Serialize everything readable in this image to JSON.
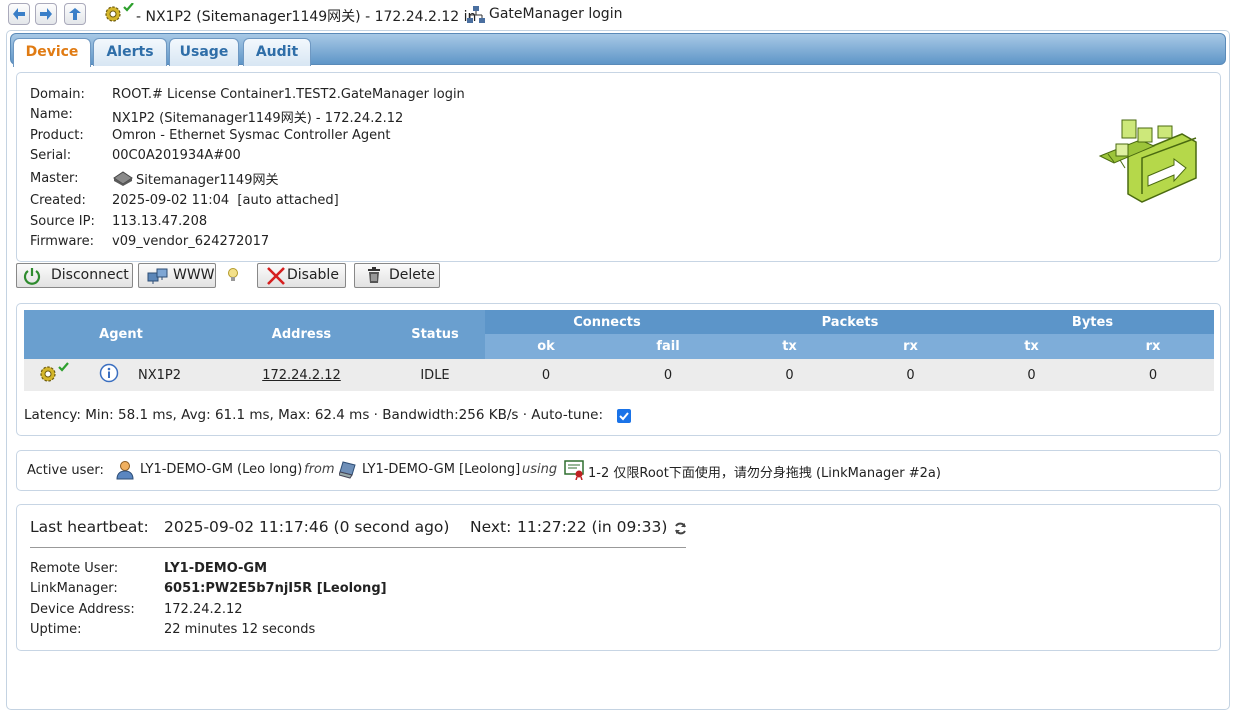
{
  "nav": {
    "title_prefix": "- NX1P2 (Sitemanager1149网关) - 172.24.2.12 in",
    "title_location": "GateManager login"
  },
  "tabs": [
    {
      "label": "Device",
      "active": true
    },
    {
      "label": "Alerts",
      "active": false
    },
    {
      "label": "Usage",
      "active": false
    },
    {
      "label": "Audit",
      "active": false
    }
  ],
  "device": {
    "domain_label": "Domain:",
    "domain": "ROOT.# License Container1.TEST2.GateManager login",
    "name_label": "Name:",
    "name": "NX1P2 (Sitemanager1149网关) - 172.24.2.12",
    "product_label": "Product:",
    "product": "Omron - Ethernet Sysmac Controller Agent",
    "serial_label": "Serial:",
    "serial": "00C0A201934A#00",
    "master_label": "Master:",
    "master": "Sitemanager1149网关",
    "created_label": "Created:",
    "created": "2025-09-02 11:04  [auto attached]",
    "source_ip_label": "Source IP:",
    "source_ip": "113.13.47.208",
    "firmware_label": "Firmware:",
    "firmware": "v09_vendor_624272017"
  },
  "actions": {
    "disconnect": "Disconnect",
    "www": "WWW",
    "disable": "Disable",
    "delete": "Delete"
  },
  "agents_table": {
    "headers": {
      "agent": "Agent",
      "address": "Address",
      "status": "Status",
      "connects": "Connects",
      "packets": "Packets",
      "bytes": "Bytes"
    },
    "sub_headers": [
      "ok",
      "fail",
      "tx",
      "rx",
      "tx",
      "rx"
    ],
    "rows": [
      {
        "agent": "NX1P2",
        "address": "172.24.2.12",
        "status": "IDLE",
        "values": [
          "0",
          "0",
          "0",
          "0",
          "0",
          "0"
        ]
      }
    ]
  },
  "latency": {
    "text": "Latency: Min: 58.1 ms, Avg: 61.1 ms, Max: 62.4 ms · Bandwidth:256 KB/s · Auto-tune:",
    "autotune": true
  },
  "active_user": {
    "label": "Active user:",
    "user": "LY1-DEMO-GM (Leo long)",
    "from": "from",
    "device": "LY1-DEMO-GM [Leolong]",
    "using": "using",
    "license": "1-2 仅限Root下面使用，请勿分身拖拽 (LinkManager #2a)"
  },
  "heartbeat": {
    "label": "Last heartbeat:",
    "value": "2025-09-02 11:17:46 (0 second ago)",
    "next_label": "Next:",
    "next_value": "11:27:22 (in 09:33)",
    "remote_user_label": "Remote User:",
    "remote_user": "LY1-DEMO-GM",
    "linkmanager_label": "LinkManager:",
    "linkmanager": "6051:PW2E5b7njI5R [Leolong]",
    "device_address_label": "Device Address:",
    "device_address": "172.24.2.12",
    "uptime_label": "Uptime:",
    "uptime": "22 minutes 12 seconds"
  },
  "colors": {
    "tab_active": "#e07b13",
    "header_blue": "#5c95c9",
    "subheader_blue": "#7eadd9",
    "icon_green": "#8cc63f"
  }
}
